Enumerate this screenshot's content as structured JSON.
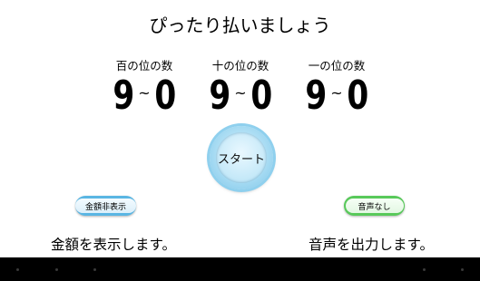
{
  "title": "ぴったり払いましょう",
  "columns": [
    {
      "label": "百の位の数",
      "from": "9",
      "tilde": "~",
      "to": "0"
    },
    {
      "label": "十の位の数",
      "from": "9",
      "tilde": "~",
      "to": "0"
    },
    {
      "label": "一の位の数",
      "from": "9",
      "tilde": "~",
      "to": "0"
    }
  ],
  "start_button": {
    "label": "スタート"
  },
  "amount_toggle": {
    "label": "金額非表示",
    "status": "金額を表示します。",
    "color": "#5ab6e3"
  },
  "sound_toggle": {
    "label": "音声なし",
    "status": "音声を出力します。",
    "color": "#58c95a"
  }
}
